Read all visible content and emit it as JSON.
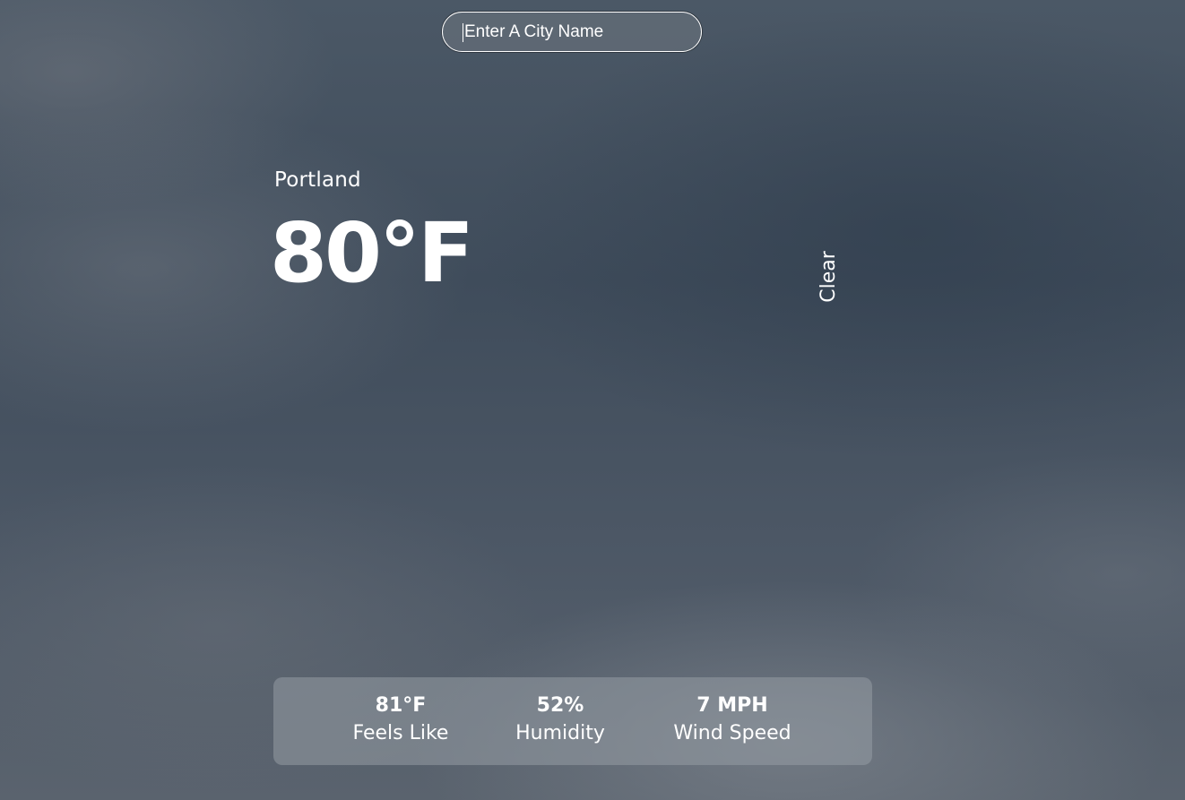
{
  "search": {
    "placeholder": "Enter A City Name",
    "value": ""
  },
  "weather": {
    "city": "Portland",
    "temperature": "80°F",
    "condition": "Clear"
  },
  "stats": {
    "feels_like": {
      "value": "81°F",
      "label": "Feels Like"
    },
    "humidity": {
      "value": "52%",
      "label": "Humidity"
    },
    "wind_speed": {
      "value": "7 MPH",
      "label": "Wind Speed"
    }
  },
  "colors": {
    "text": "#ffffff",
    "background": "#4a5562"
  }
}
